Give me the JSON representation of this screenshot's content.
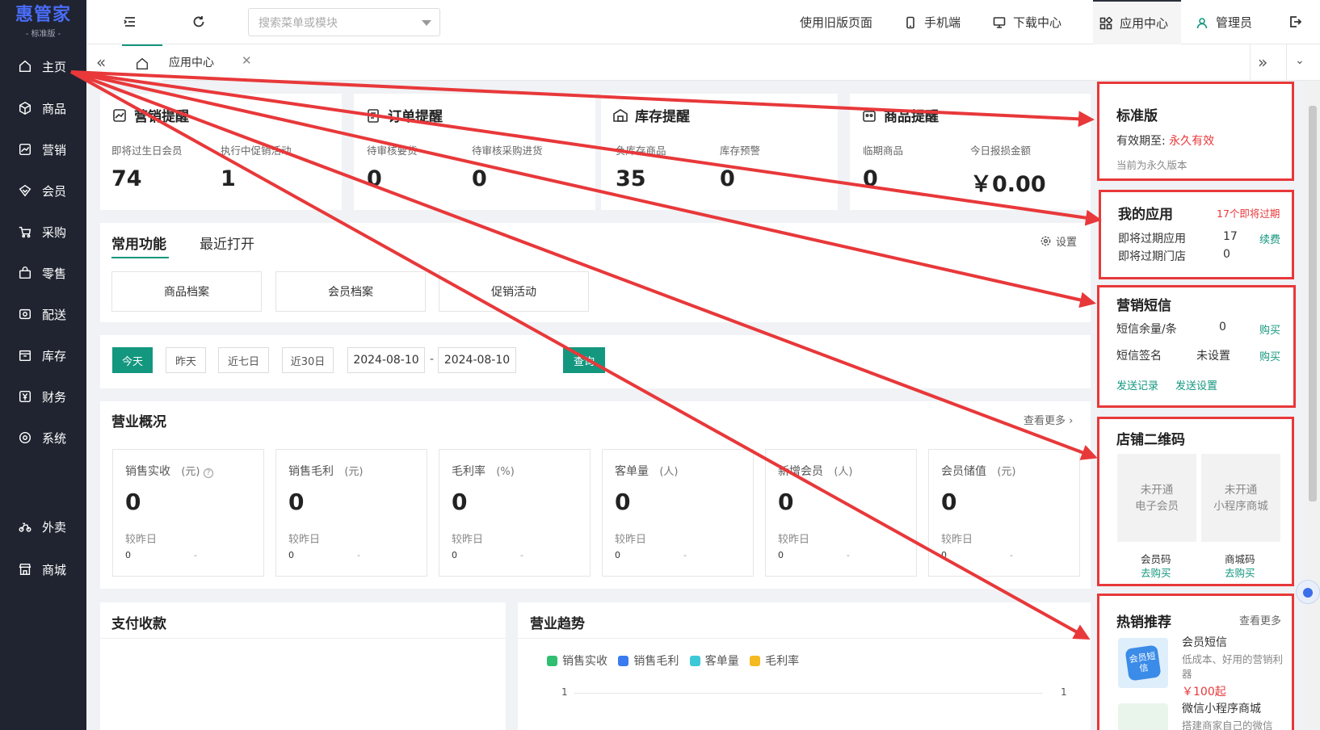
{
  "app": {
    "logo": "惠管家",
    "edition": "- 标准版 -"
  },
  "sidebar": {
    "items": [
      {
        "label": "主页",
        "icon": "home-icon"
      },
      {
        "label": "商品",
        "icon": "box-icon"
      },
      {
        "label": "营销",
        "icon": "chart-icon"
      },
      {
        "label": "会员",
        "icon": "diamond-icon"
      },
      {
        "label": "采购",
        "icon": "cart-icon"
      },
      {
        "label": "零售",
        "icon": "bag-icon"
      },
      {
        "label": "配送",
        "icon": "truck-icon"
      },
      {
        "label": "库存",
        "icon": "storage-icon"
      },
      {
        "label": "财务",
        "icon": "yen-icon"
      },
      {
        "label": "系统",
        "icon": "settings-icon"
      },
      {
        "label": "外卖",
        "icon": "scooter-icon"
      },
      {
        "label": "商城",
        "icon": "shop-icon"
      }
    ]
  },
  "topbar": {
    "search_placeholder": "搜索菜单或模块",
    "old_page": "使用旧版页面",
    "mobile": "手机端",
    "download": "下载中心",
    "app_center": "应用中心",
    "user": "管理员"
  },
  "tabs": {
    "current": "应用中心"
  },
  "reminders": [
    {
      "title": "营销提醒",
      "stats": [
        {
          "label": "即将过生日会员",
          "value": "74"
        },
        {
          "label": "执行中促销活动",
          "value": "1"
        }
      ]
    },
    {
      "title": "订单提醒",
      "stats": [
        {
          "label": "待审核要货",
          "value": "0"
        },
        {
          "label": "待审核采购进货",
          "value": "0"
        }
      ]
    },
    {
      "title": "库存提醒",
      "stats": [
        {
          "label": "负库存商品",
          "value": "35"
        },
        {
          "label": "库存预警",
          "value": "0"
        }
      ]
    },
    {
      "title": "商品提醒",
      "stats": [
        {
          "label": "临期商品",
          "value": "0"
        },
        {
          "label": "今日报损金额",
          "value": "￥0.00"
        }
      ]
    }
  ],
  "functions": {
    "tab_common": "常用功能",
    "tab_recent": "最近打开",
    "settings": "设置",
    "buttons": [
      "商品档案",
      "会员档案",
      "促销活动"
    ]
  },
  "date_filter": {
    "today": "今天",
    "yesterday": "昨天",
    "last7": "近七日",
    "last30": "近30日",
    "start": "2024-08-10",
    "sep": "-",
    "end": "2024-08-10",
    "query": "查询"
  },
  "overview": {
    "title": "营业概况",
    "more": "查看更多",
    "metrics": [
      {
        "label": "销售实收",
        "unit": "(元)",
        "value": "0",
        "compare": "较昨日",
        "prev": "0",
        "delta": "-"
      },
      {
        "label": "销售毛利",
        "unit": "(元)",
        "value": "0",
        "compare": "较昨日",
        "prev": "0",
        "delta": "-"
      },
      {
        "label": "毛利率",
        "unit": "(%)",
        "value": "0",
        "compare": "较昨日",
        "prev": "0",
        "delta": "-"
      },
      {
        "label": "客单量",
        "unit": "(人)",
        "value": "0",
        "compare": "较昨日",
        "prev": "0",
        "delta": "-"
      },
      {
        "label": "新增会员",
        "unit": "(人)",
        "value": "0",
        "compare": "较昨日",
        "prev": "0",
        "delta": "-"
      },
      {
        "label": "会员储值",
        "unit": "(元)",
        "value": "0",
        "compare": "较昨日",
        "prev": "0",
        "delta": "-"
      }
    ]
  },
  "payment": {
    "title": "支付收款"
  },
  "trend": {
    "title": "营业趋势",
    "legend": [
      {
        "name": "销售实收",
        "color": "#2fbf71"
      },
      {
        "name": "销售毛利",
        "color": "#3b7bf0"
      },
      {
        "name": "客单量",
        "color": "#3cc8d6"
      },
      {
        "name": "毛利率",
        "color": "#f5b921"
      }
    ],
    "y_left": "1",
    "y_right": "1"
  },
  "edition": {
    "title": "标准版",
    "validity_label": "有效期至:",
    "validity_value": "永久有效",
    "note": "当前为永久版本"
  },
  "my_apps": {
    "title": "我的应用",
    "badge": "17个即将过期",
    "rows": [
      {
        "label": "即将过期应用",
        "value": "17",
        "action": "续费"
      },
      {
        "label": "即将过期门店",
        "value": "0",
        "action": ""
      }
    ]
  },
  "sms": {
    "title": "营销短信",
    "rows": [
      {
        "label": "短信余量/条",
        "value": "0",
        "action": "购买"
      },
      {
        "label": "短信签名",
        "value": "未设置",
        "action": "购买"
      }
    ],
    "links": [
      "发送记录",
      "发送设置"
    ]
  },
  "qrcode": {
    "title": "店铺二维码",
    "items": [
      {
        "box_l1": "未开通",
        "box_l2": "电子会员",
        "name": "会员码",
        "action": "去购买"
      },
      {
        "box_l1": "未开通",
        "box_l2": "小程序商城",
        "name": "商城码",
        "action": "去购买"
      }
    ]
  },
  "hot": {
    "title": "热销推荐",
    "more": "查看更多",
    "items": [
      {
        "name": "会员短信",
        "desc": "低成本、好用的营销利器",
        "price": "￥100起",
        "img_text": "会员短信"
      },
      {
        "name": "微信小程序商城",
        "desc": "搭建商家自己的微信"
      }
    ]
  },
  "colors": {
    "accent": "#14977f",
    "sidebar": "#1f2430",
    "annotation": "#e8383a"
  }
}
